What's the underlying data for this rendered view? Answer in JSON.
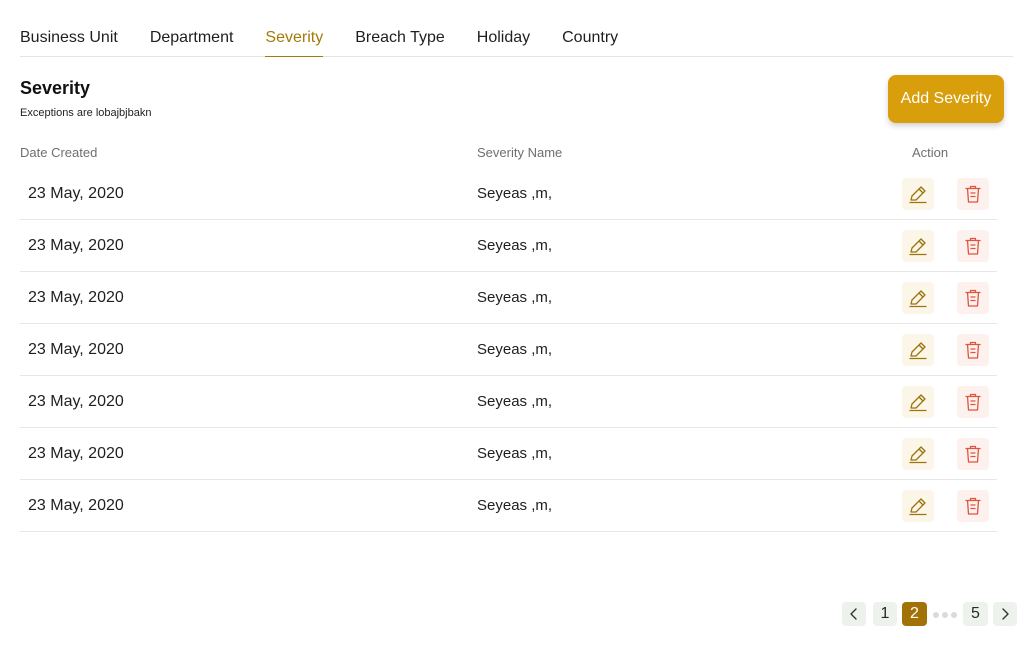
{
  "tabs": [
    {
      "label": "Business Unit",
      "active": false
    },
    {
      "label": "Department",
      "active": false
    },
    {
      "label": "Severity",
      "active": true
    },
    {
      "label": "Breach Type",
      "active": false
    },
    {
      "label": "Holiday",
      "active": false
    },
    {
      "label": "Country",
      "active": false
    }
  ],
  "header": {
    "title": "Severity",
    "subtitle": "Exceptions are lobajbjbakn",
    "add_button_label": "Add Severity"
  },
  "table": {
    "columns": {
      "date": "Date Created",
      "name": "Severity Name",
      "action": "Action"
    },
    "rows": [
      {
        "date": "23 May, 2020",
        "name": "Seyeas ,m,"
      },
      {
        "date": "23 May, 2020",
        "name": "Seyeas ,m,"
      },
      {
        "date": "23 May, 2020",
        "name": "Seyeas ,m,"
      },
      {
        "date": "23 May, 2020",
        "name": "Seyeas ,m,"
      },
      {
        "date": "23 May, 2020",
        "name": "Seyeas ,m,"
      },
      {
        "date": "23 May, 2020",
        "name": "Seyeas ,m,"
      },
      {
        "date": "23 May, 2020",
        "name": "Seyeas ,m,"
      }
    ]
  },
  "pagination": {
    "prev_icon": "chevron-left-icon",
    "pages": [
      "1",
      "2",
      "5"
    ],
    "current": "2",
    "ellipsis_icon": "more-dots-icon",
    "next_icon": "chevron-right-icon"
  },
  "icons": {
    "edit": "pencil-icon",
    "delete": "trash-icon"
  },
  "colors": {
    "accent": "#a47b09",
    "button": "#d99e0b",
    "edit_bg": "#fbf6e8",
    "delete_bg": "#fdf1ee",
    "delete_icon": "#e0533d",
    "page_active": "#a37206",
    "page_bg": "#edf2ec"
  }
}
